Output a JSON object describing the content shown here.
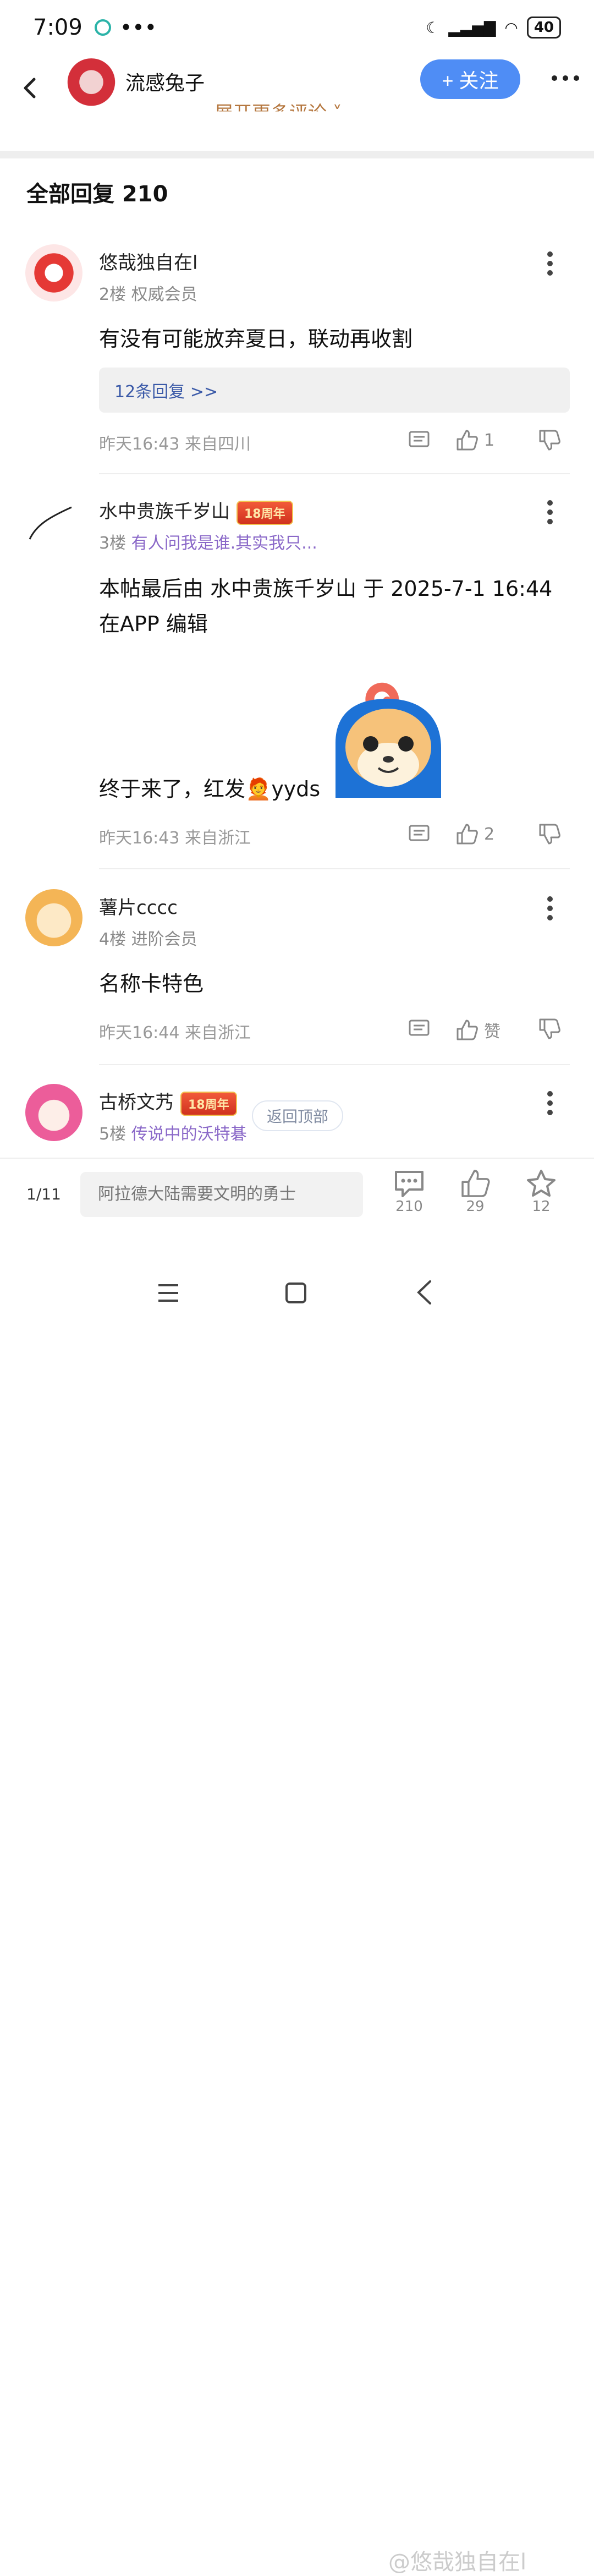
{
  "status_bar": {
    "time": "7:09",
    "dots": "•••",
    "battery": "40"
  },
  "header": {
    "username": "流感兔子",
    "follow_label": "+ 关注",
    "expand_text": "展开更多评论 ˅"
  },
  "section_title": "全部回复 210",
  "posts": [
    {
      "username": "悠哉独自在l",
      "floor": "2楼",
      "role": "权威会员",
      "content": "有没有可能放弃夏日，联动再收割",
      "replies_label": "12条回复 >>",
      "meta": "昨天16:43 来自四川",
      "likes": "1"
    },
    {
      "username": "水中贵族千岁山",
      "badge": "18周年",
      "floor": "3楼",
      "role": "有人问我是谁.其实我只...",
      "content_line1": "本帖最后由 水中贵族千岁山 于 2025-7-1 16:44",
      "content_line2": "在APP 编辑",
      "content_line3": "终于来了，红发🧑‍🦰yyds",
      "meta": "昨天16:43 来自浙江",
      "likes": "2"
    },
    {
      "username": "薯片cccc",
      "floor": "4楼",
      "role": "进阶会员",
      "content": "名称卡特色",
      "meta": "昨天16:44 来自浙江",
      "likes": "赞"
    },
    {
      "username": "古桥文艿",
      "badge": "18周年",
      "floor": "5楼",
      "role": "传说中的沃特碁"
    }
  ],
  "back_to_top": "返回顶部",
  "bottom_bar": {
    "page": "1/11",
    "placeholder": "阿拉德大陆需要文明的勇士",
    "comments": "210",
    "likes": "29",
    "favorites": "12"
  },
  "watermark": "@悠哉独自在l",
  "colors": {
    "accent": "#4f8df5",
    "purple": "#8a68c8",
    "badge": "#e0452a"
  }
}
